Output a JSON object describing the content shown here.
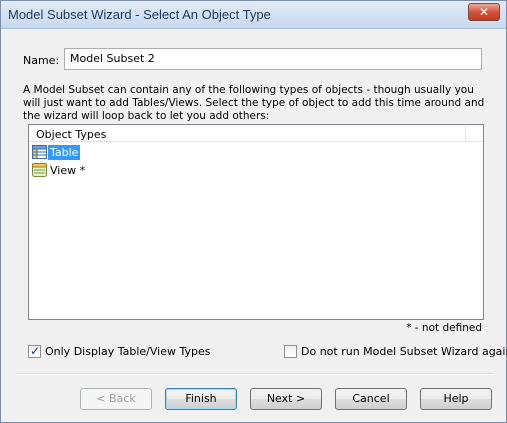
{
  "window": {
    "title": "Model Subset Wizard - Select An Object Type",
    "close_glyph": "✕"
  },
  "name_field": {
    "label": "Name:",
    "value": "Model Subset 2"
  },
  "description": "A Model Subset can contain any of the following types of objects - though usually you will just want to add Tables/Views.  Select the type of object to add this time around and the wizard will loop back to let you add others:",
  "object_list": {
    "header": "Object Types",
    "items": [
      {
        "label": "Table",
        "icon": "table-icon",
        "selected": true
      },
      {
        "label": "View *",
        "icon": "view-icon",
        "selected": false
      }
    ]
  },
  "note": "* - not defined",
  "checkboxes": {
    "only_display": {
      "label": "Only Display Table/View Types",
      "checked": true
    },
    "do_not_run": {
      "label": "Do not run Model Subset Wizard again",
      "checked": false
    }
  },
  "buttons": {
    "back": "< Back",
    "finish": "Finish",
    "next": "Next >",
    "cancel": "Cancel",
    "help": "Help"
  }
}
